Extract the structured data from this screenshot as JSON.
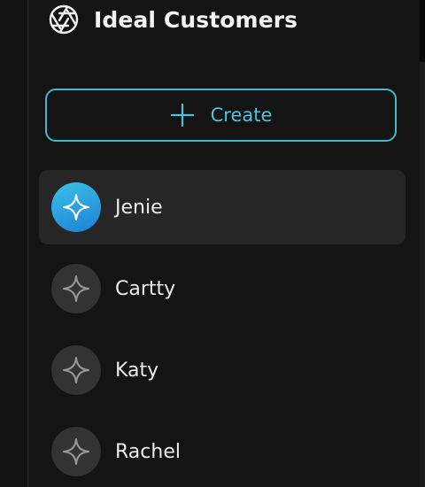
{
  "header": {
    "title": "Ideal Customers",
    "icon": "aperture-icon"
  },
  "create_button": {
    "label": "Create",
    "icon": "plus-icon",
    "accent_color": "#46b7ce"
  },
  "customers": [
    {
      "name": "Jenie",
      "icon": "sparkle-icon",
      "active": true
    },
    {
      "name": "Cartty",
      "icon": "sparkle-icon",
      "active": false
    },
    {
      "name": "Katy",
      "icon": "sparkle-icon",
      "active": false
    },
    {
      "name": "Rachel",
      "icon": "sparkle-icon",
      "active": false
    }
  ],
  "colors": {
    "background": "#141414",
    "active_item": "#262626",
    "active_avatar": "#2a9be0",
    "inactive_avatar": "#333333"
  }
}
